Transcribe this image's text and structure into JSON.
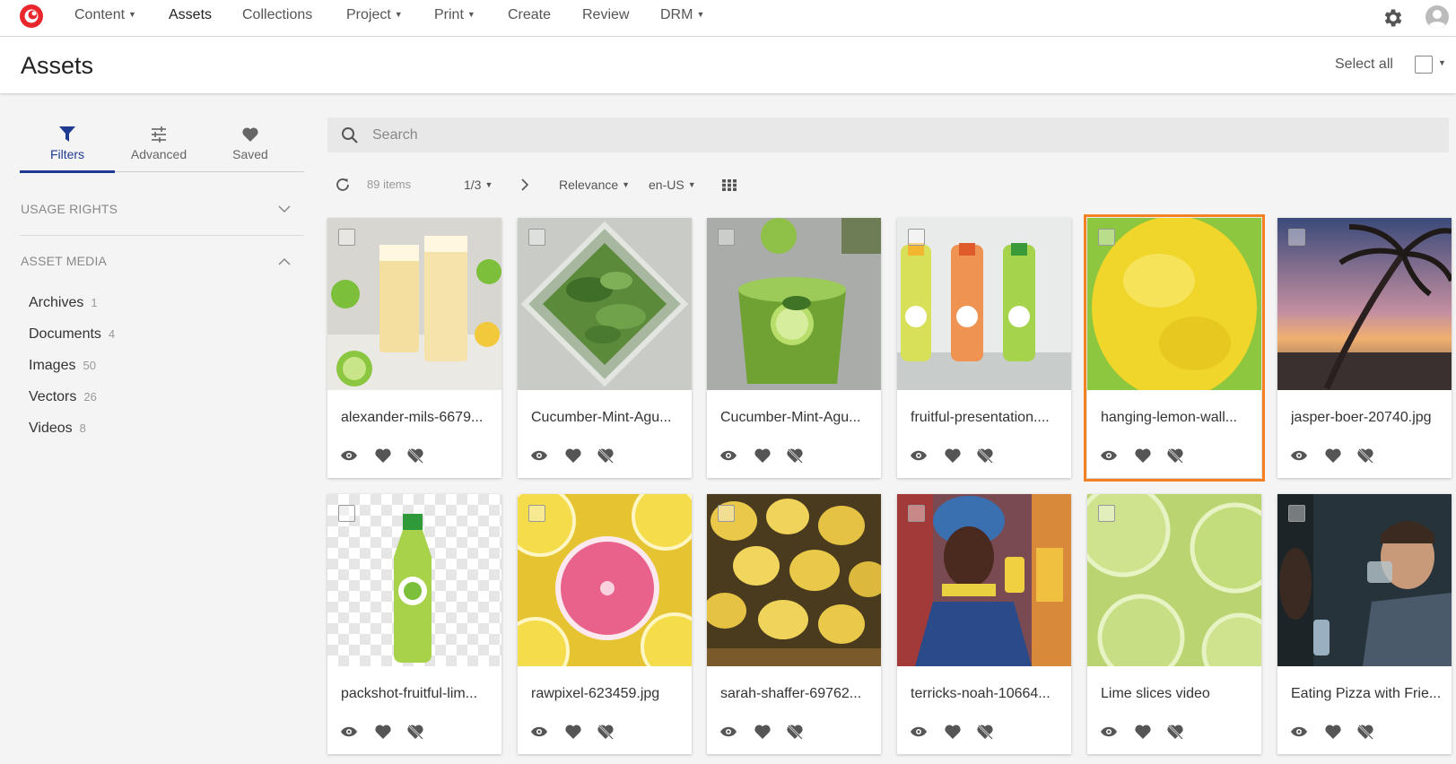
{
  "nav": {
    "items": [
      {
        "label": "Content",
        "dropdown": true
      },
      {
        "label": "Assets",
        "dropdown": false,
        "active": true
      },
      {
        "label": "Collections",
        "dropdown": false
      },
      {
        "label": "Project",
        "dropdown": true
      },
      {
        "label": "Print",
        "dropdown": true
      },
      {
        "label": "Create",
        "dropdown": false
      },
      {
        "label": "Review",
        "dropdown": false
      },
      {
        "label": "DRM",
        "dropdown": true
      }
    ],
    "brand_color": "#e8262b"
  },
  "header": {
    "title": "Assets",
    "select_all_label": "Select all"
  },
  "sidebar": {
    "tabs": [
      {
        "label": "Filters",
        "icon": "filter-icon",
        "active": true
      },
      {
        "label": "Advanced",
        "icon": "sliders-icon"
      },
      {
        "label": "Saved",
        "icon": "heart-icon"
      }
    ],
    "sections": [
      {
        "title": "USAGE RIGHTS",
        "expanded": false
      },
      {
        "title": "ASSET MEDIA",
        "expanded": true
      }
    ],
    "media_items": [
      {
        "label": "Archives",
        "count": "1"
      },
      {
        "label": "Documents",
        "count": "4"
      },
      {
        "label": "Images",
        "count": "50"
      },
      {
        "label": "Vectors",
        "count": "26"
      },
      {
        "label": "Videos",
        "count": "8"
      }
    ]
  },
  "search": {
    "placeholder": "Search"
  },
  "toolbar": {
    "item_count": "89 items",
    "page": "1/3",
    "sort": "Relevance",
    "locale": "en-US"
  },
  "assets": [
    {
      "name": "alexander-mils-6679...",
      "thumb": "lemonade-glasses"
    },
    {
      "name": "Cucumber-Mint-Agu...",
      "thumb": "mint-jar"
    },
    {
      "name": "Cucumber-Mint-Agu...",
      "thumb": "green-drink"
    },
    {
      "name": "fruitful-presentation....",
      "thumb": "bottles"
    },
    {
      "name": "hanging-lemon-wall...",
      "thumb": "lemon-closeup",
      "selected": true
    },
    {
      "name": "jasper-boer-20740.jpg",
      "thumb": "palm-sunset"
    },
    {
      "name": "packshot-fruitful-lim...",
      "thumb": "single-bottle"
    },
    {
      "name": "rawpixel-623459.jpg",
      "thumb": "citrus-slices"
    },
    {
      "name": "sarah-shaffer-69762...",
      "thumb": "lemon-basket"
    },
    {
      "name": "terricks-noah-10664...",
      "thumb": "woman-drink"
    },
    {
      "name": "Lime slices video",
      "thumb": "lime-slices"
    },
    {
      "name": "Eating Pizza with Frie...",
      "thumb": "man-drinking"
    }
  ],
  "colors": {
    "accent": "#1f3a93",
    "selection": "#f58020"
  }
}
